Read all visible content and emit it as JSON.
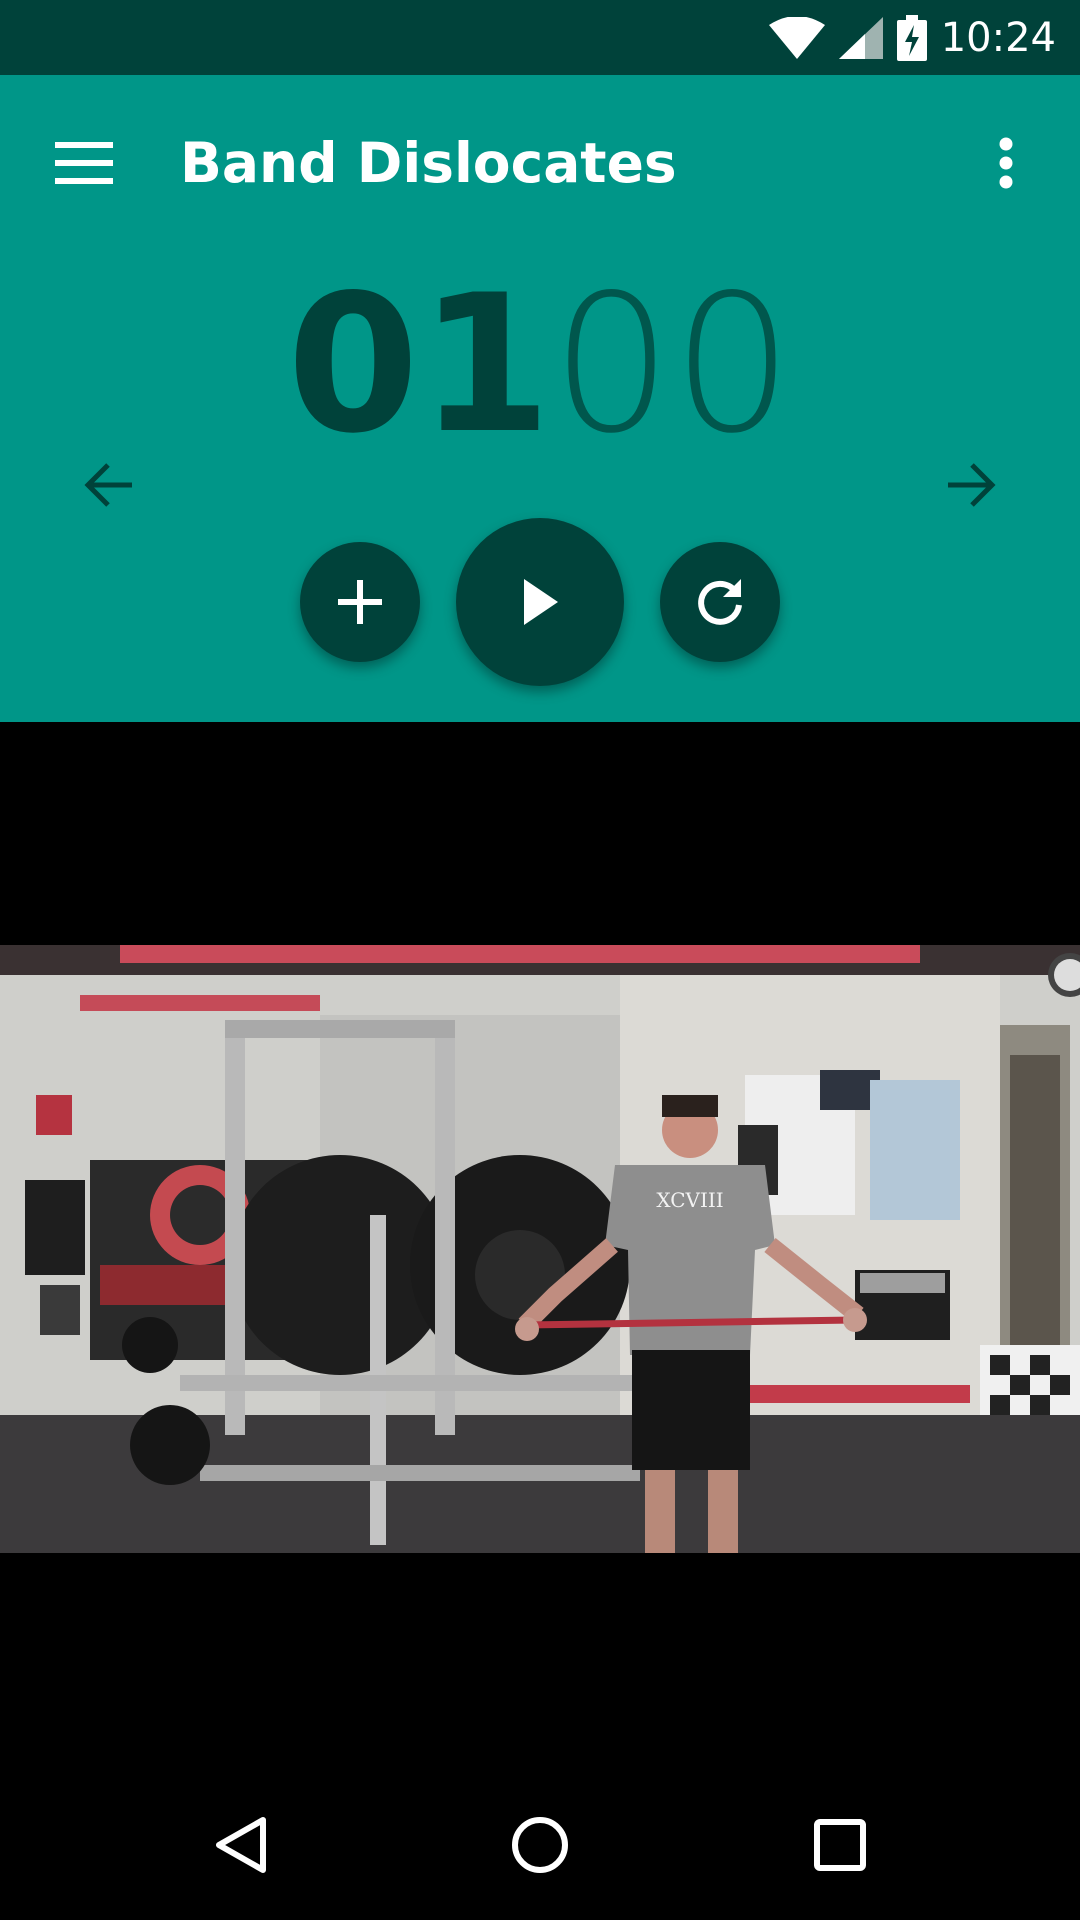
{
  "status_bar": {
    "time": "10:24",
    "icons": [
      "wifi-icon",
      "cell-signal-icon",
      "battery-charging-icon"
    ]
  },
  "toolbar": {
    "title": "Band Dislocates",
    "menu_icon": "hamburger-menu-icon",
    "more_icon": "more-vert-icon"
  },
  "timer": {
    "minutes": "01",
    "seconds": "00"
  },
  "controls": {
    "prev_icon": "arrow-left-icon",
    "next_icon": "arrow-right-icon",
    "add_icon": "add-icon",
    "play_icon": "play-icon",
    "reset_icon": "replay-icon"
  },
  "video": {
    "shirt_text": "XCVIII"
  },
  "nav_bar": {
    "icons": [
      "back-icon",
      "home-icon",
      "recents-icon"
    ]
  },
  "colors": {
    "primary": "#009688",
    "primary_dark": "#00423a",
    "accent_text": "#00423a"
  }
}
